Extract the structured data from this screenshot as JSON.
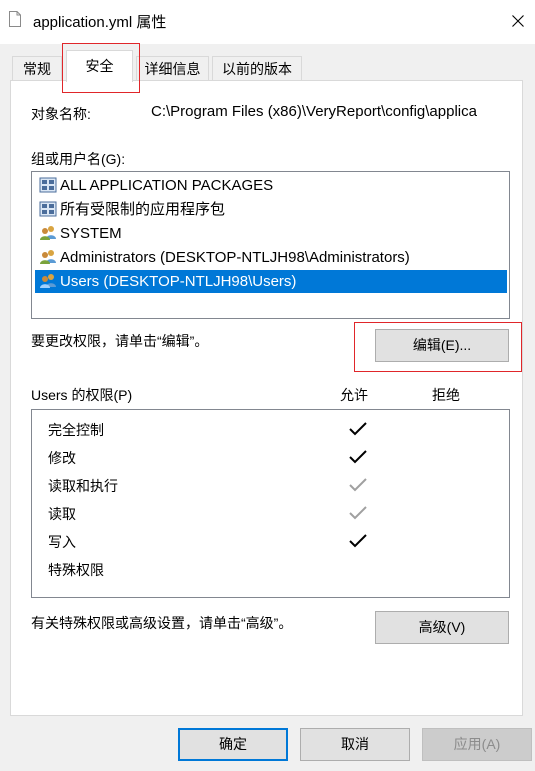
{
  "window": {
    "title": "application.yml 属性",
    "close_icon": "close-icon",
    "file_icon": "file-icon"
  },
  "tabs": [
    {
      "label": "常规",
      "active": false
    },
    {
      "label": "安全",
      "active": true
    },
    {
      "label": "详细信息",
      "active": false
    },
    {
      "label": "以前的版本",
      "active": false
    }
  ],
  "object": {
    "label": "对象名称:",
    "value": "C:\\Program Files (x86)\\VeryReport\\config\\applica"
  },
  "groups": {
    "label": "组或用户名(G):",
    "items": [
      {
        "label": "ALL APPLICATION PACKAGES",
        "icon": "app-package-icon",
        "selected": false
      },
      {
        "label": "所有受限制的应用程序包",
        "icon": "app-package-icon",
        "selected": false
      },
      {
        "label": "SYSTEM",
        "icon": "users-group-icon",
        "selected": false
      },
      {
        "label": "Administrators (DESKTOP-NTLJH98\\Administrators)",
        "icon": "users-group-icon",
        "selected": false
      },
      {
        "label": "Users (DESKTOP-NTLJH98\\Users)",
        "icon": "users-group-icon",
        "selected": true
      }
    ]
  },
  "edit": {
    "hint": "要更改权限，请单击“编辑”。",
    "button": "编辑(E)..."
  },
  "permissions": {
    "title": "Users 的权限(P)",
    "allow_header": "允许",
    "deny_header": "拒绝",
    "rows": [
      {
        "name": "完全控制",
        "allow": "checked",
        "deny": "none"
      },
      {
        "name": "修改",
        "allow": "checked",
        "deny": "none"
      },
      {
        "name": "读取和执行",
        "allow": "grayed",
        "deny": "none"
      },
      {
        "name": "读取",
        "allow": "grayed",
        "deny": "none"
      },
      {
        "name": "写入",
        "allow": "checked",
        "deny": "none"
      },
      {
        "name": "特殊权限",
        "allow": "none",
        "deny": "none"
      }
    ]
  },
  "advanced": {
    "hint": "有关特殊权限或高级设置，请单击“高级”。",
    "button": "高级(V)"
  },
  "footer": {
    "ok": "确定",
    "cancel": "取消",
    "apply": "应用(A)"
  },
  "colors": {
    "selection": "#0078d7",
    "highlight_box": "#e0262a",
    "check_dark": "#000000",
    "check_gray": "#a0a0a0"
  }
}
